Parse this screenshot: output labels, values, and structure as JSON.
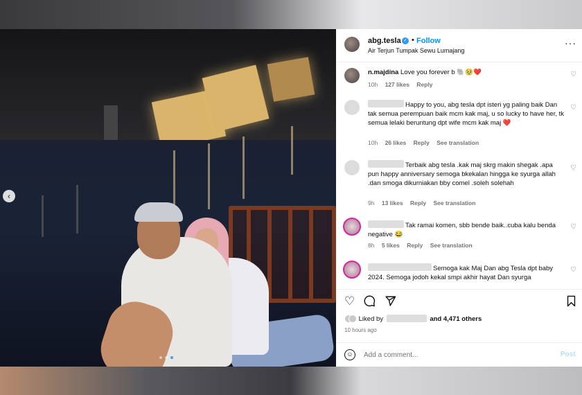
{
  "post": {
    "username": "abg.tesla",
    "follow_label": "Follow",
    "separator": "•",
    "location": "Air Terjun Tumpak Sewu Lumajang",
    "more_icon": "more-horizontal-icon",
    "image_alt": "Selfie of couple at night by the river"
  },
  "comments": [
    {
      "user": "n.majdina",
      "text": "Love you forever b 🐘🥹❤️",
      "time": "10h",
      "likes": "127 likes",
      "reply": "Reply",
      "translate": ""
    },
    {
      "user": "",
      "text": "Happy to you, abg tesla dpt isteri yg paling baik Dan tak semua perempuan baik mcm kak maj, u so lucky to have her, tk semua lelaki beruntung dpt wife mcm kak maj ❤️",
      "time": "10h",
      "likes": "26 likes",
      "reply": "Reply",
      "translate": "See translation"
    },
    {
      "user": "",
      "text": "Terbaik abg tesla .kak maj skrg makin shegak .apa pun happy anniversary semoga bkekalan hingga ke syurga allah .dan smoga dikurniakan bby comel .soleh solehah",
      "time": "9h",
      "likes": "13 likes",
      "reply": "Reply",
      "translate": "See translation"
    },
    {
      "user": "",
      "text": "Tak ramai komen, sbb bende baik..cuba kalu benda negative 😂",
      "time": "8h",
      "likes": "5 likes",
      "reply": "Reply",
      "translate": "See translation"
    },
    {
      "user": "",
      "text": "Semoga kak Maj Dan abg Tesla dpt baby 2024. Semoga jodoh kekal smpi akhir hayat Dan syurga",
      "time": "",
      "likes": "",
      "reply": "",
      "translate": ""
    }
  ],
  "likes": {
    "liked_by_label": "Liked by",
    "and_others": "and 4,471 others"
  },
  "time_ago": "10 hours ago",
  "add_comment": {
    "placeholder": "Add a comment...",
    "post_label": "Post"
  },
  "icons": {
    "like": "heart-icon",
    "comment": "comment-icon",
    "share": "share-icon",
    "save": "bookmark-icon",
    "emoji": "emoji-icon",
    "prev": "chevron-left-icon"
  },
  "colors": {
    "link_blue": "#0095f6",
    "verified_blue": "#3797f0",
    "muted_text": "#737373",
    "post_disabled": "#b2dffc"
  }
}
